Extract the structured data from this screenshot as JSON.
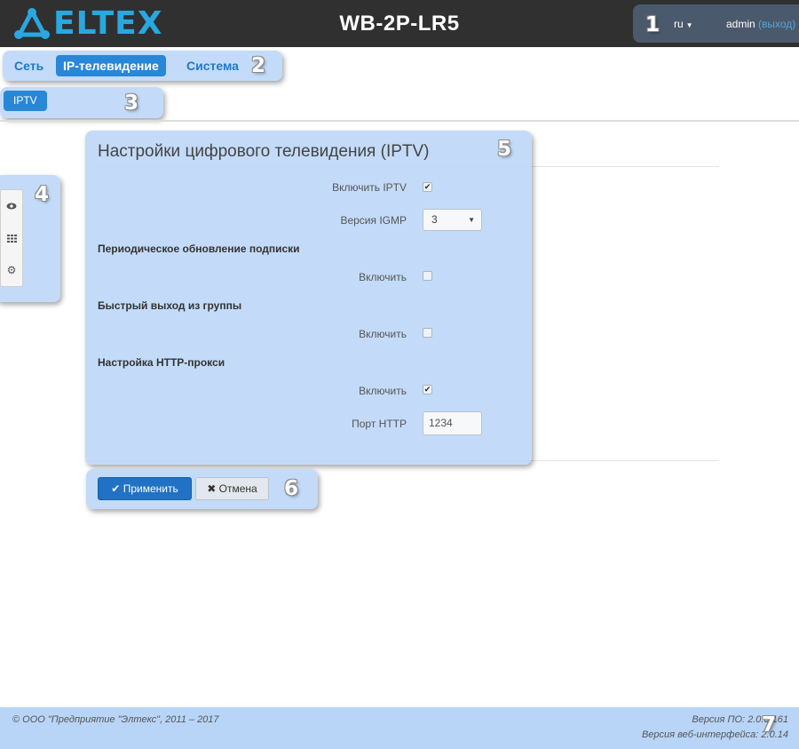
{
  "header": {
    "logo_text": "ELTEX",
    "device_title": "WB-2P-LR5",
    "language": "ru",
    "user": "admin",
    "logout_label": "(выход)"
  },
  "nav": {
    "items": [
      {
        "label": "Сеть",
        "active": false
      },
      {
        "label": "IP-телевидение",
        "active": true
      },
      {
        "label": "Система",
        "active": false
      }
    ]
  },
  "subnav": {
    "items": [
      {
        "label": "IPTV",
        "active": true
      }
    ]
  },
  "sidebar": {
    "buttons": [
      "eye-icon",
      "grid-icon",
      "gear-icon"
    ]
  },
  "panel": {
    "title": "Настройки цифрового телевидения (IPTV)",
    "enable_iptv_label": "Включить IPTV",
    "enable_iptv_checked": true,
    "igmp_label": "Версия IGMP",
    "igmp_value": "3",
    "section_periodic": "Периодическое обновление подписки",
    "periodic_enable_label": "Включить",
    "periodic_enable_checked": false,
    "section_fastleave": "Быстрый выход из группы",
    "fastleave_enable_label": "Включить",
    "fastleave_enable_checked": false,
    "section_proxy": "Настройка HTTP-прокси",
    "proxy_enable_label": "Включить",
    "proxy_enable_checked": true,
    "http_port_label": "Порт HTTP",
    "http_port_value": "1234"
  },
  "buttons": {
    "apply_label": "Применить",
    "cancel_label": "Отмена"
  },
  "footer": {
    "copyright": "© ООО \"Предприятие \"Элтекс\", 2011 – 2017",
    "firmware_version": "Версия ПО: 2.0.0.161",
    "web_version": "Версия веб-интерфейса: 2.0.14"
  },
  "markers": [
    "1",
    "2",
    "3",
    "4",
    "5",
    "6",
    "7"
  ],
  "colors": {
    "header_bg": "#303030",
    "brand": "#29a8e0",
    "active_nav": "#2887d6",
    "highlight": "#b8d5f7"
  }
}
